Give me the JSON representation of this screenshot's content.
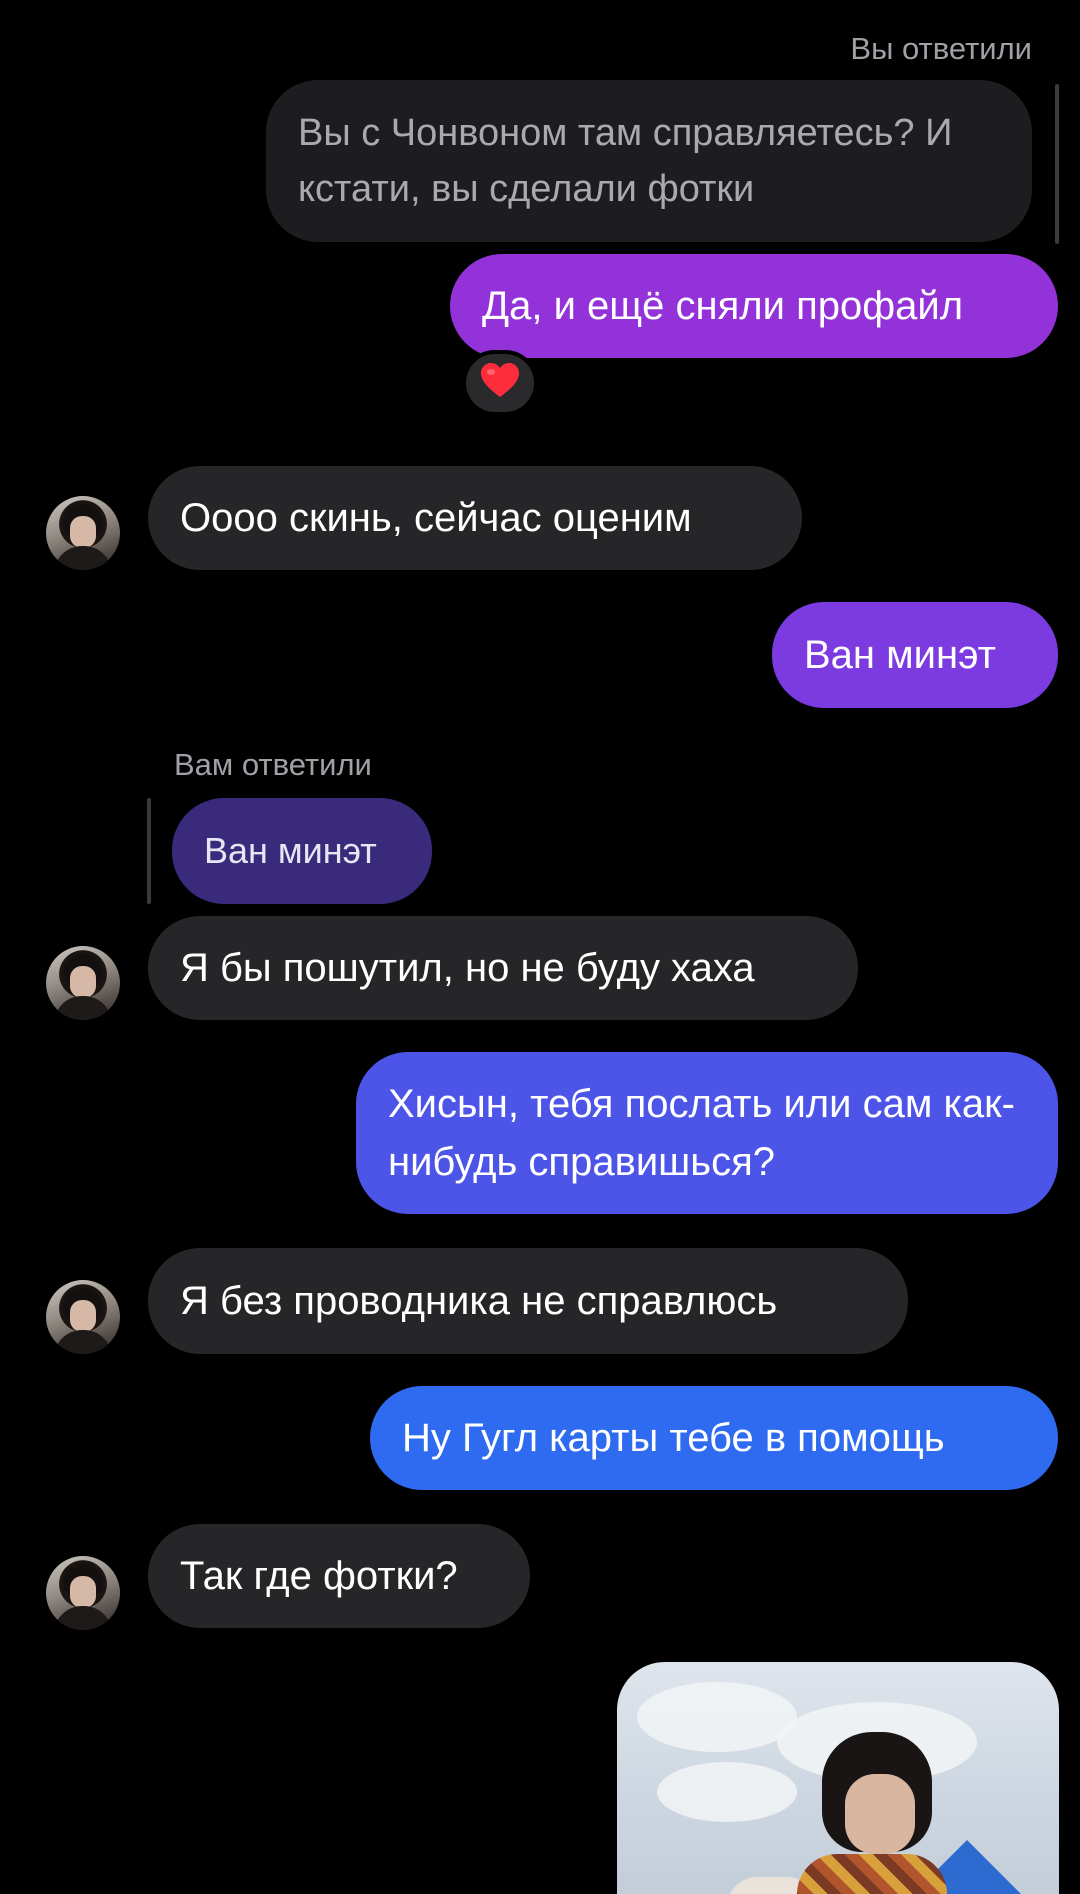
{
  "theme": {
    "background": "#000000",
    "incoming_bubble": "#262629",
    "outgoing_gradient": [
      "#9a2fd0",
      "#7a3ae0",
      "#4a55e8",
      "#2e6ff0"
    ],
    "reaction_emoji_color": "#ff2d3b"
  },
  "messages": {
    "reply_you_caption": "Вы ответили",
    "quoted_own_message": "Вы с Чонвоном там справляетесь? И кстати, вы сделали фотки",
    "out_1": "Да, и ещё сняли профайл",
    "out_1_reaction": "❤️",
    "in_1": "Оооо скинь, сейчас оценим",
    "out_2": "Ван минэт",
    "reply_them_caption": "Вам ответили",
    "quoted_their_reply": "Ван минэт",
    "in_2": "Я бы пошутил, но не буду хаха",
    "out_3": "Хисын, тебя послать или сам как-нибудь справишься?",
    "in_3": "Я без проводника не справлюсь",
    "out_4": "Ну Гугл карты тебе в помощь",
    "in_4": "Так где фотки?"
  },
  "icons": {
    "avatar": "contact-avatar",
    "reaction": "red-heart-emoji",
    "photo": "sent-photo-thumbnail"
  }
}
